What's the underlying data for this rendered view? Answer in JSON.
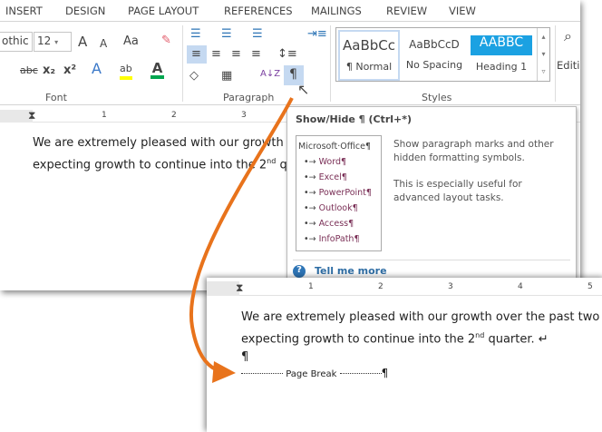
{
  "tabs": [
    "INSERT",
    "DESIGN",
    "PAGE LAYOUT",
    "REFERENCES",
    "MAILINGS",
    "REVIEW",
    "VIEW"
  ],
  "font": {
    "name": "othic",
    "size": "12",
    "group_label": "Font",
    "grow": "A",
    "shrink": "A",
    "case": "Aa",
    "strike": "abc",
    "sub": "x₂",
    "sup": "x²",
    "effects": "A",
    "highlight": "ab",
    "color": "A",
    "highlight_color": "#ffff00",
    "font_color": "#00a650"
  },
  "paragraph": {
    "group_label": "Paragraph",
    "show_hide": "¶",
    "sort": "A↓Z"
  },
  "styles": {
    "group_label": "Styles",
    "items": [
      {
        "preview": "AaBbCc",
        "label": "¶ Normal"
      },
      {
        "preview": "AaBbCcD",
        "label": "No Spacing"
      },
      {
        "preview": "AABBC",
        "label": "Heading 1"
      }
    ],
    "heading_color": "#1ba1e2"
  },
  "editing": {
    "label": "Editing"
  },
  "ruler": [
    "1",
    "2",
    "3",
    "4",
    "5"
  ],
  "doc1": {
    "line1": "We are extremely pleased with our growth o",
    "line2_a": "expecting growth to continue into the 2",
    "line2_sup": "nd",
    "line2_b": " quar"
  },
  "tooltip": {
    "title": "Show/Hide ¶ (Ctrl+*)",
    "sample_root": "Microsoft·Office¶",
    "sample_items": [
      "Word¶",
      "Excel¶",
      "PowerPoint¶",
      "Outlook¶",
      "Access¶",
      "InfoPath¶"
    ],
    "desc1": "Show paragraph marks and other hidden formatting symbols.",
    "desc2": "This is especially useful for advanced layout tasks.",
    "link": "Tell me more"
  },
  "doc2": {
    "line1": "We are extremely pleased with our growth over the past two qu",
    "line2_a": "expecting growth to continue into the 2",
    "line2_sup": "nd",
    "line2_b": " quarter. ↵",
    "line3": "¶",
    "page_break": "Page Break",
    "page_break_mark": "¶"
  },
  "accent": "#e8731c"
}
